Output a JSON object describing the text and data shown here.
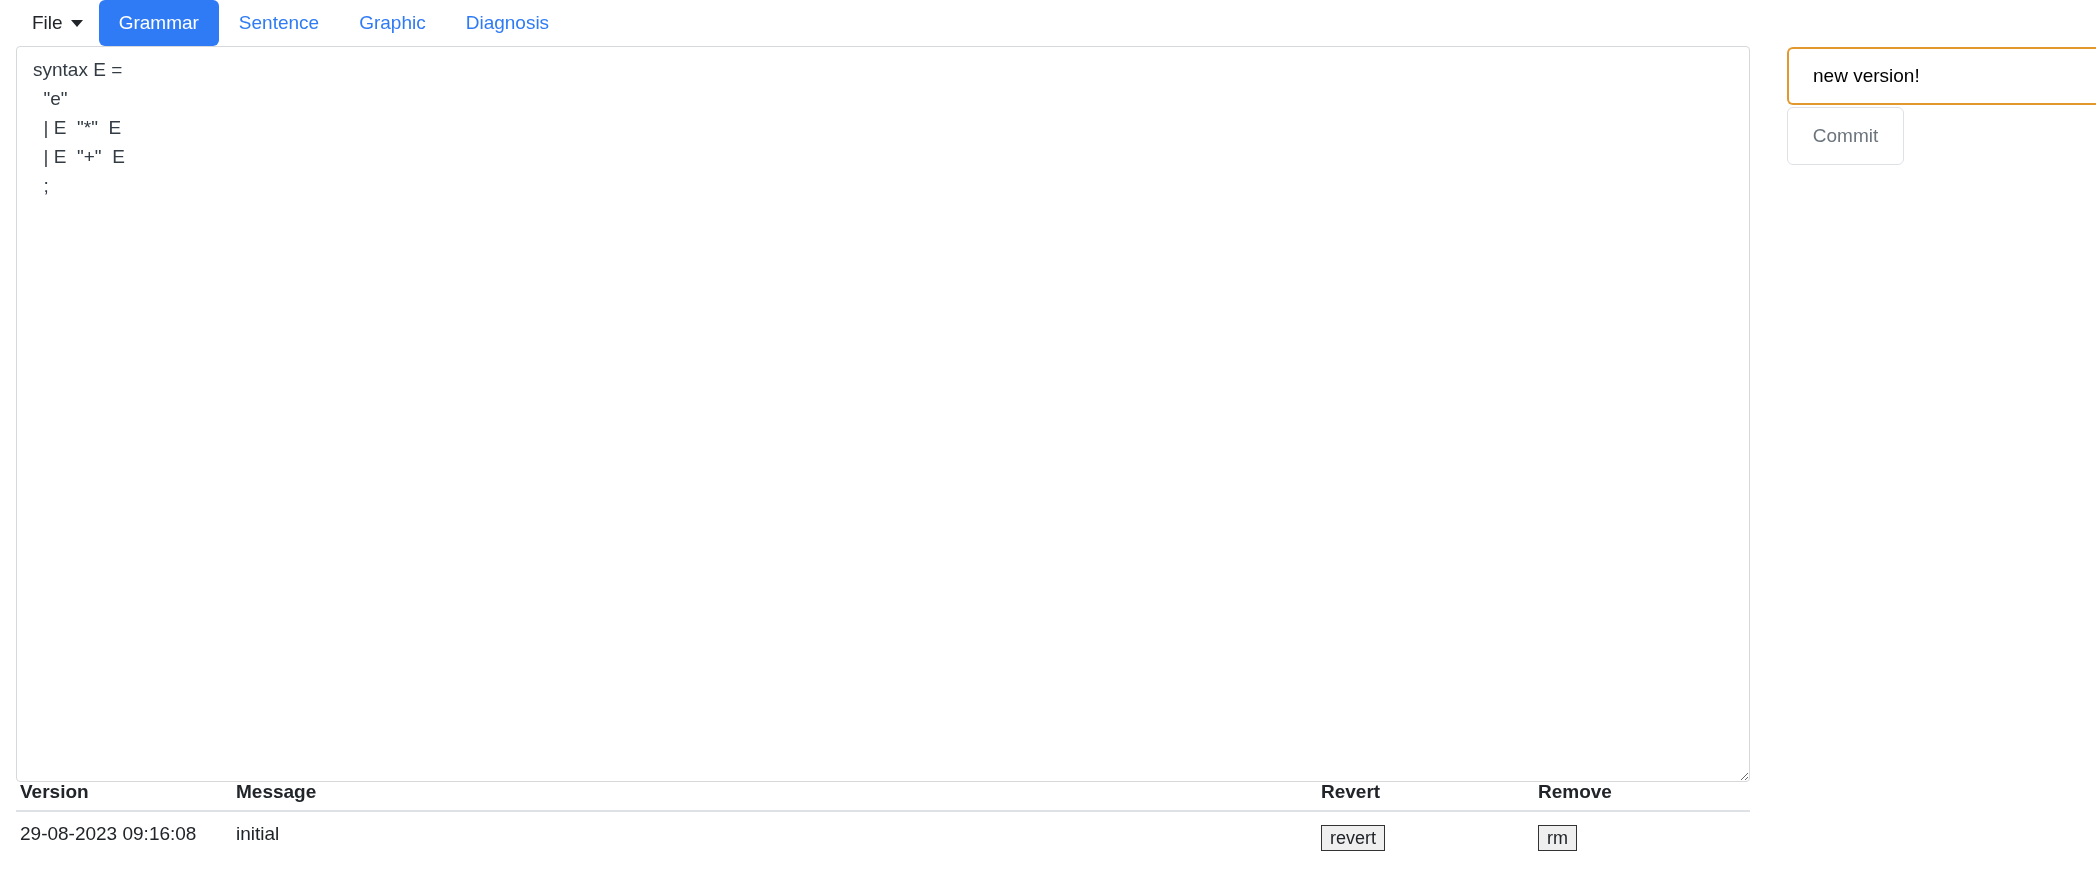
{
  "menu": {
    "label": "File"
  },
  "tabs": [
    {
      "label": "Grammar",
      "selected": true
    },
    {
      "label": "Sentence",
      "selected": false
    },
    {
      "label": "Graphic",
      "selected": false
    },
    {
      "label": "Diagnosis",
      "selected": false
    }
  ],
  "editor": {
    "value": "syntax E =\n  \"e\"\n  | E  \"*\"  E\n  | E  \"+\"  E\n  ;"
  },
  "commit": {
    "value": "new version!",
    "button": "Commit"
  },
  "table": {
    "columns": [
      "Version",
      "Message",
      "Revert",
      "Remove"
    ],
    "rows": [
      {
        "version": "29-08-2023 09:16:08",
        "message": "initial",
        "revert": "revert",
        "remove": "rm"
      }
    ]
  }
}
